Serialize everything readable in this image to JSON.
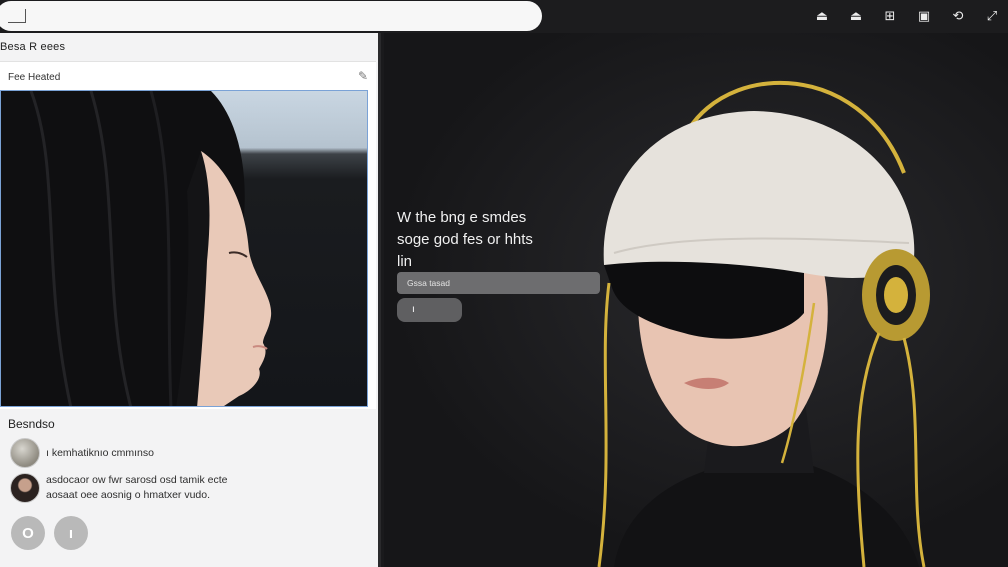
{
  "topbar": {
    "icons": [
      {
        "name": "home-icon",
        "glyph": "⏏"
      },
      {
        "name": "user-icon",
        "glyph": "⏏"
      },
      {
        "name": "gallery-icon",
        "glyph": "⊞"
      },
      {
        "name": "save-icon",
        "glyph": "▣"
      },
      {
        "name": "share-icon",
        "glyph": "⟲"
      },
      {
        "name": "expand-icon",
        "glyph": "⤢"
      }
    ]
  },
  "left_panel": {
    "header": "Besa R eees",
    "card": {
      "title": "Fee Heated"
    },
    "description": {
      "title": "Besndso",
      "items": [
        {
          "text": "ı kemhatiknıo cmmınso"
        },
        {
          "text": "asdocaor ow fwr sarosd osd tamik ecte\naosaat oee aosnig o hmatxer vudo."
        }
      ],
      "buttons": [
        {
          "label": "O"
        },
        {
          "label": "ı"
        }
      ]
    }
  },
  "right_area": {
    "headline": "W the bng e smdes\nsoge god fes or hhts\nlin",
    "field_label": "Gssa tasad",
    "button_label": "ı"
  },
  "colors": {
    "background": "#1a1a1c",
    "panel": "#f3f3f4",
    "accent_gold": "#d4b23c",
    "selection_border": "#7aa2d6"
  }
}
